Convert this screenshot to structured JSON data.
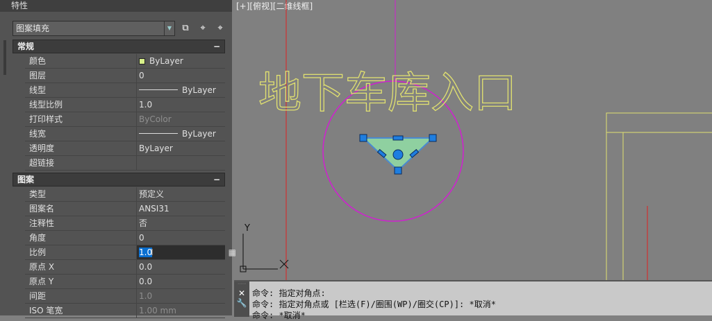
{
  "panel": {
    "title": "特性",
    "object_type": "图案填充"
  },
  "sections": {
    "general": {
      "title": "常规",
      "collapse": "−",
      "rows": [
        {
          "label": "颜色",
          "value": "ByLayer"
        },
        {
          "label": "图层",
          "value": "0"
        },
        {
          "label": "线型",
          "value": "ByLayer"
        },
        {
          "label": "线型比例",
          "value": "1.0"
        },
        {
          "label": "打印样式",
          "value": "ByColor"
        },
        {
          "label": "线宽",
          "value": "ByLayer"
        },
        {
          "label": "透明度",
          "value": "ByLayer"
        },
        {
          "label": "超链接",
          "value": ""
        }
      ]
    },
    "pattern": {
      "title": "图案",
      "collapse": "−",
      "rows": [
        {
          "label": "类型",
          "value": "预定义"
        },
        {
          "label": "图案名",
          "value": "ANSI31"
        },
        {
          "label": "注释性",
          "value": "否"
        },
        {
          "label": "角度",
          "value": "0"
        },
        {
          "label": "比例",
          "value": "1.0"
        },
        {
          "label": "原点 X",
          "value": "0.0"
        },
        {
          "label": "原点 Y",
          "value": "0.0"
        },
        {
          "label": "间距",
          "value": "1.0"
        },
        {
          "label": "ISO 笔宽",
          "value": "1.00 mm"
        }
      ]
    }
  },
  "viewport": {
    "label": "[+][俯视][二维线框]",
    "drawing_text": "地下车库入口",
    "ucs_x": "X",
    "ucs_y": "Y"
  },
  "command": {
    "lines": [
      "命令: 指定对角点:",
      "命令: 指定对角点或 [栏选(F)/圈围(WP)/圈交(CP)]: *取消*",
      "命令: *取消*"
    ]
  },
  "colors": {
    "swatch": "#d8f08a",
    "magenta": "#d020d0",
    "red": "#e02020",
    "yellow": "#e0e070"
  }
}
